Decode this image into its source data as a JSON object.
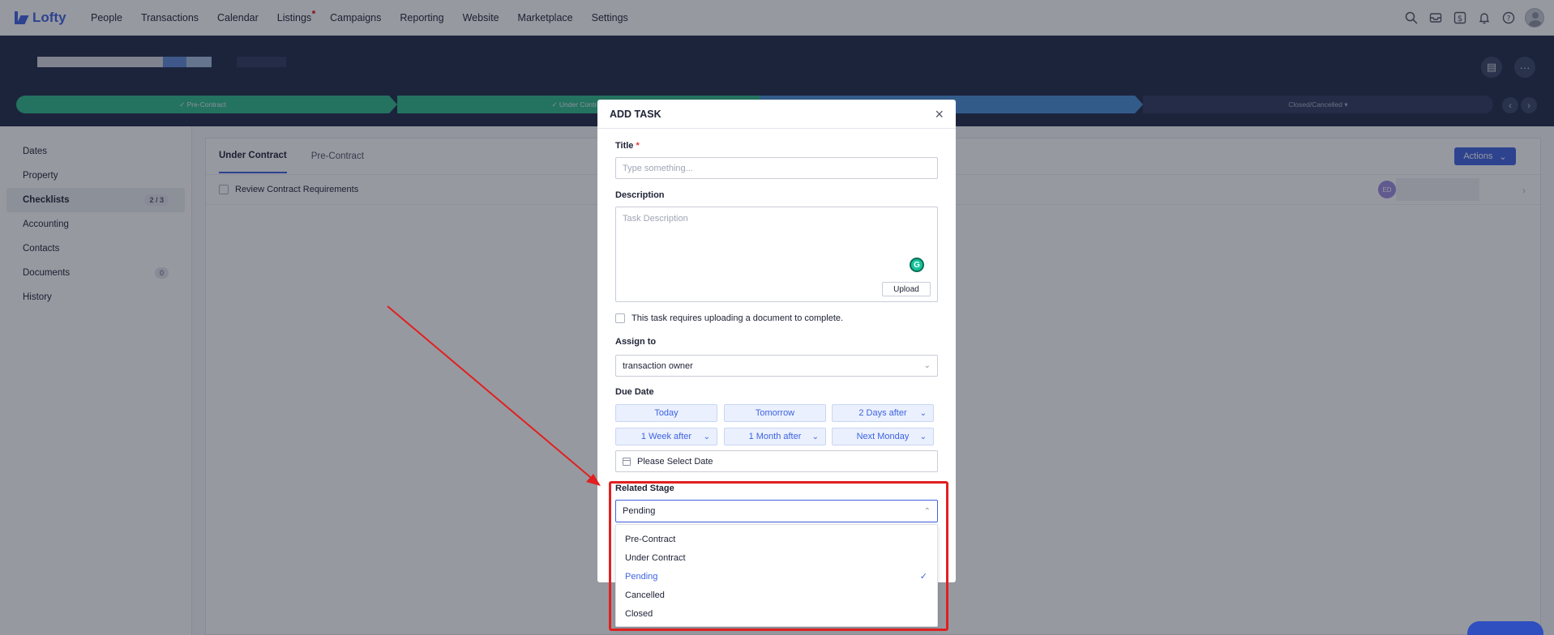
{
  "nav": {
    "logo": "Lofty",
    "items": [
      "People",
      "Transactions",
      "Calendar",
      "Listings",
      "Campaigns",
      "Reporting",
      "Website",
      "Marketplace",
      "Settings"
    ]
  },
  "stages": {
    "items": [
      "Pre-Contract",
      "Under Contract",
      "Closed/Cancelled"
    ]
  },
  "sidebar": {
    "items": [
      {
        "label": "Dates",
        "badge": ""
      },
      {
        "label": "Property",
        "badge": ""
      },
      {
        "label": "Checklists",
        "badge": "2 / 3"
      },
      {
        "label": "Accounting",
        "badge": ""
      },
      {
        "label": "Contacts",
        "badge": ""
      },
      {
        "label": "Documents",
        "badge": "0"
      },
      {
        "label": "History",
        "badge": ""
      }
    ]
  },
  "main": {
    "tabs": [
      "Under Contract",
      "Pre-Contract"
    ],
    "actions_label": "Actions",
    "task": "Review Contract Requirements",
    "assignee_initials": "ED"
  },
  "modal": {
    "title": "ADD TASK",
    "title_label": "Title",
    "title_placeholder": "Type something...",
    "description_label": "Description",
    "description_placeholder": "Task Description",
    "upload_label": "Upload",
    "upload_required_text": "This task requires uploading a document to complete.",
    "assign_label": "Assign to",
    "assign_value": "transaction owner",
    "due_label": "Due Date",
    "due_buttons": [
      "Today",
      "Tomorrow",
      "2 Days after",
      "1 Week after",
      "1 Month after",
      "Next Monday"
    ],
    "date_placeholder": "Please Select Date",
    "stage_label": "Related Stage",
    "stage_value": "Pending",
    "stage_options": [
      "Pre-Contract",
      "Under Contract",
      "Pending",
      "Cancelled",
      "Closed"
    ]
  },
  "colors": {
    "brand": "#3e63e0",
    "stage_done": "#2fb98a",
    "stage_current": "#4a8fd8",
    "annotation": "#e02020"
  }
}
